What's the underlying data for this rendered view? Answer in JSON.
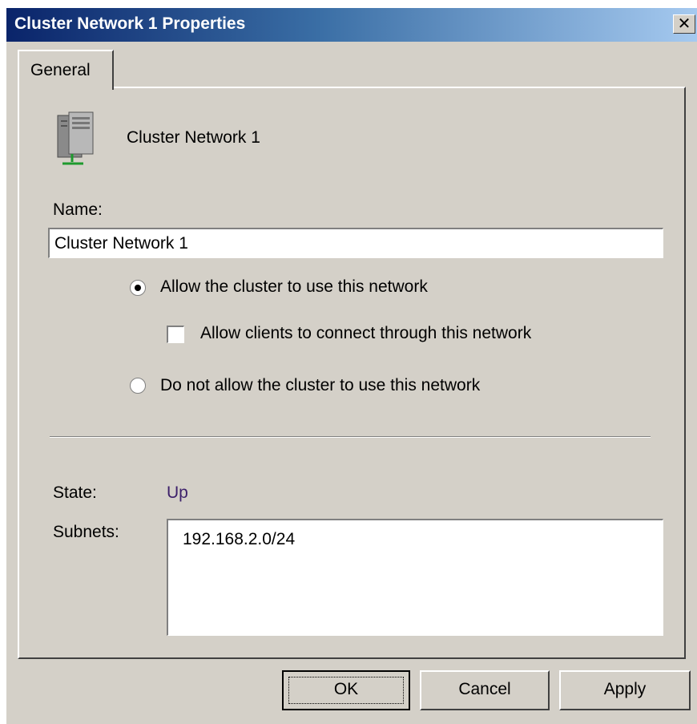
{
  "window": {
    "title": "Cluster Network 1 Properties",
    "close_glyph": "✕"
  },
  "tabs": [
    {
      "label": "General",
      "active": true
    }
  ],
  "general": {
    "header_icon": "cluster-network-server-icon",
    "header_text": "Cluster Network 1",
    "name_label": "Name:",
    "name_value": "Cluster Network 1",
    "options": {
      "allow_cluster": {
        "label": "Allow the cluster to use this network",
        "selected": true
      },
      "allow_clients": {
        "label": "Allow clients to connect through this network",
        "checked": false
      },
      "disallow_cluster": {
        "label": "Do not allow the cluster to use this network",
        "selected": false
      }
    },
    "state_label": "State:",
    "state_value": "Up",
    "subnets_label": "Subnets:",
    "subnets": [
      "192.168.2.0/24"
    ]
  },
  "buttons": {
    "ok": "OK",
    "cancel": "Cancel",
    "apply": "Apply"
  },
  "colors": {
    "title_gradient_start": "#0a246a",
    "title_gradient_end": "#a6caf0",
    "dialog_face": "#d4d0c8",
    "state_value": "#3c1f6a"
  }
}
